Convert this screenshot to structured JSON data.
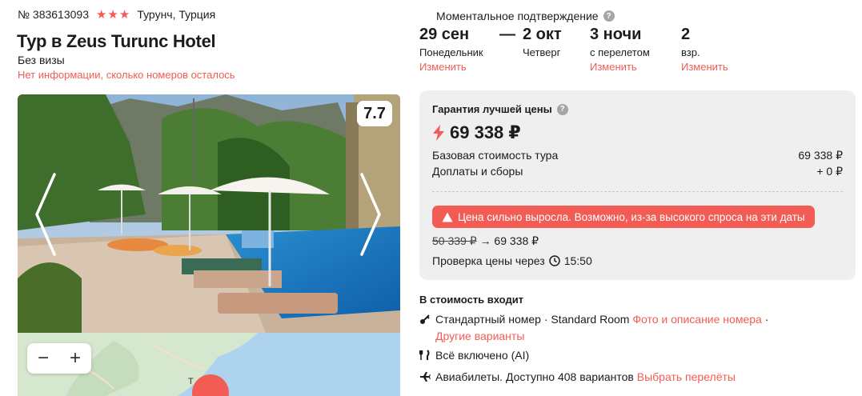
{
  "tour": {
    "number": "№ 383613093",
    "stars": "★★★",
    "location": "Турунч, Турция",
    "title": "Тур в Zeus Turunc Hotel",
    "visa": "Без визы",
    "rooms_note": "Нет информации, сколько номеров осталось"
  },
  "gallery": {
    "rating": "7.7",
    "prev_icon": "chevron-left-icon",
    "next_icon": "chevron-right-icon"
  },
  "map": {
    "zoom_out": "−",
    "zoom_in": "+",
    "label": "Т"
  },
  "booking": {
    "instant_confirmation": "Моментальное подтверждение",
    "help_icon_text": "?",
    "dash": "—",
    "date_from": "29 сен",
    "weekday_from": "Понедельник",
    "date_to": "2 окт",
    "weekday_to": "Четверг",
    "nights": "3 ночи",
    "nights_sub": "с перелетом",
    "adults": "2",
    "adults_sub": "взр.",
    "change_label": "Изменить"
  },
  "price": {
    "guarantee": "Гарантия лучшей цены",
    "total": "69 338 ₽",
    "base_label": "Базовая стоимость тура",
    "base_value": "69 338 ₽",
    "fees_label": "Доплаты и сборы",
    "fees_value": "+ 0 ₽",
    "alert": "Цена сильно выросла. Возможно, из-за высокого спроса на эти даты",
    "old_price": "50 339 ₽",
    "arrow": "→",
    "new_price": "69 338 ₽",
    "check_label": "Проверка цены через",
    "check_time": "15:50"
  },
  "included": {
    "title": "В стоимость входит",
    "room_text": "Стандартный номер · Standard Room",
    "room_link": "Фото и описание номера",
    "room_dot": "·",
    "other_link": "Другие варианты",
    "meal": "Всё включено (AI)",
    "flights_text": "Авиабилеты. Доступно 408 вариантов",
    "flights_link": "Выбрать перелёты"
  },
  "colors": {
    "accent": "#f25c54",
    "panel": "#efefef"
  }
}
